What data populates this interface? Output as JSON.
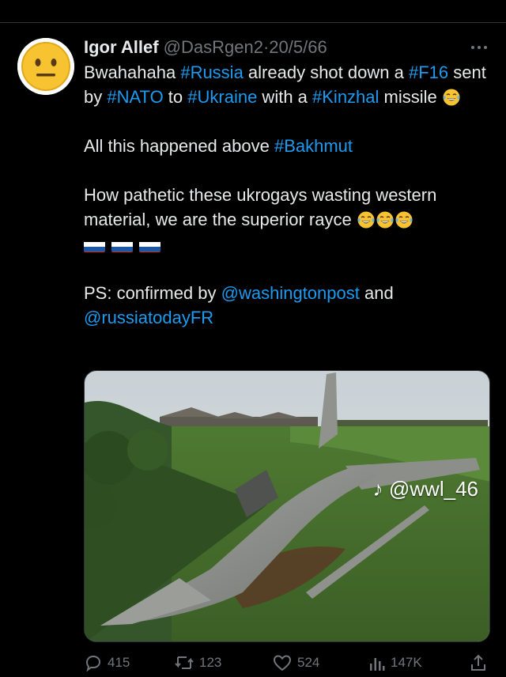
{
  "tweet": {
    "author_name": "Igor Allef",
    "handle": "@DasRgen2",
    "separator": "·",
    "date": "20/5/66",
    "paragraphs": [
      [
        {
          "t": "Bwahahaha ",
          "k": "text"
        },
        {
          "t": "#Russia",
          "k": "tag"
        },
        {
          "t": " already shot down a ",
          "k": "text"
        },
        {
          "t": "#F16",
          "k": "tag"
        },
        {
          "t": " sent by ",
          "k": "text"
        },
        {
          "t": "#NATO",
          "k": "tag"
        },
        {
          "t": " to ",
          "k": "text"
        },
        {
          "t": "#Ukraine",
          "k": "tag"
        },
        {
          "t": " with a ",
          "k": "text"
        },
        {
          "t": "#Kinzhal",
          "k": "tag"
        },
        {
          "t": " missile ",
          "k": "text"
        },
        {
          "t": "laughing-crying",
          "k": "emoji"
        }
      ],
      [
        {
          "t": "All this happened above ",
          "k": "text"
        },
        {
          "t": "#Bakhmut",
          "k": "tag"
        }
      ],
      [
        {
          "t": "How pathetic these ukrogays wasting western material, we are the superior rayce ",
          "k": "text"
        },
        {
          "t": "laughing-crying",
          "k": "emoji"
        },
        {
          "t": "laughing-crying",
          "k": "emoji"
        },
        {
          "t": "laughing-crying",
          "k": "emoji"
        },
        {
          "t": "",
          "k": "br"
        },
        {
          "t": "russia-flag",
          "k": "flag"
        },
        {
          "t": "russia-flag",
          "k": "flag"
        },
        {
          "t": "russia-flag",
          "k": "flag"
        }
      ],
      [
        {
          "t": "PS: confirmed by ",
          "k": "text"
        },
        {
          "t": "@washingtonpost",
          "k": "tag"
        },
        {
          "t": " and ",
          "k": "text"
        },
        {
          "t": "@russiatodayFR",
          "k": "tag"
        }
      ]
    ],
    "media": {
      "watermark": "@wwl_46",
      "watermark_icon": "tiktok-icon"
    },
    "stats": {
      "replies": "415",
      "retweets": "123",
      "likes": "524",
      "views": "147K"
    }
  },
  "icons": {
    "more": "more-icon",
    "reply": "reply-icon",
    "retweet": "retweet-icon",
    "like": "heart-icon",
    "views": "views-icon",
    "share": "share-icon"
  },
  "colors": {
    "background": "#000000",
    "text": "#e7e9ea",
    "muted": "#71767b",
    "link": "#1d9bf0",
    "divider": "#2f3336"
  }
}
